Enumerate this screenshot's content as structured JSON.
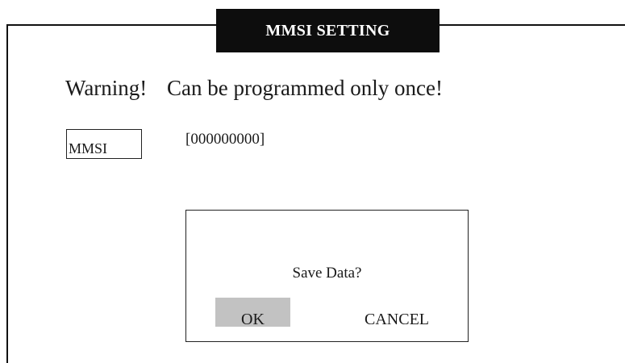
{
  "title": "MMSI SETTING",
  "warning": {
    "label": "Warning!",
    "message": "Can be programmed only once!"
  },
  "mmsi": {
    "label": "MMSI",
    "value": "[000000000]"
  },
  "dialog": {
    "prompt": "Save Data?",
    "ok_label": "OK",
    "cancel_label": "CANCEL",
    "selected": "OK"
  },
  "colors": {
    "title_bg": "#0d0d0d",
    "title_fg": "#ffffff",
    "selected_button_bg": "#c2c2c2"
  }
}
